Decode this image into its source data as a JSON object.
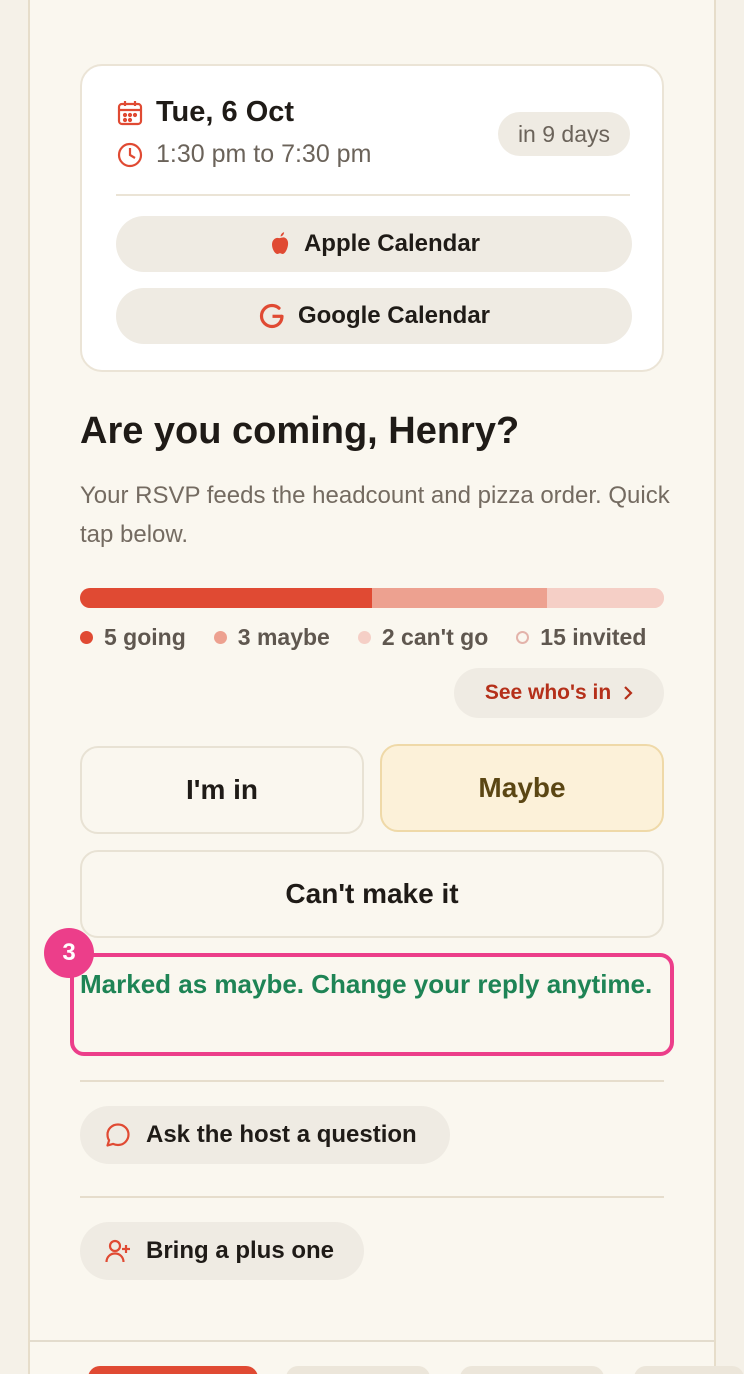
{
  "event": {
    "date": "Tue, 6 Oct",
    "time": "1:30 pm to 7:30 pm",
    "countdown": "in 9 days",
    "apple_calendar": "Apple Calendar",
    "google_calendar": "Google Calendar"
  },
  "rsvp": {
    "heading": "Are you coming, Henry?",
    "subtext": "Your RSVP feeds the headcount and pizza order. Quick tap below.",
    "summary": {
      "going": 5,
      "maybe": 3,
      "cant_go": 2,
      "invited": 15,
      "going_label": "5 going",
      "maybe_label": "3 maybe",
      "cant_go_label": "2 can't go",
      "invited_label": "15 invited"
    },
    "see_whos_in": "See who's in",
    "options": {
      "in": "I'm in",
      "maybe": "Maybe",
      "cant": "Can't make it"
    },
    "selected": "maybe",
    "status_message": "Marked as maybe. Change your reply anytime.",
    "annotation_number": "3"
  },
  "actions": {
    "ask_host": "Ask the host a question",
    "plus_one": "Bring a plus one"
  },
  "colors": {
    "accent": "#e04a33",
    "going": "#e04a33",
    "maybe": "#eda190",
    "cant_go": "#f5cfc6",
    "status_green": "#1e8455",
    "highlight_pink": "#ec3e8a"
  }
}
